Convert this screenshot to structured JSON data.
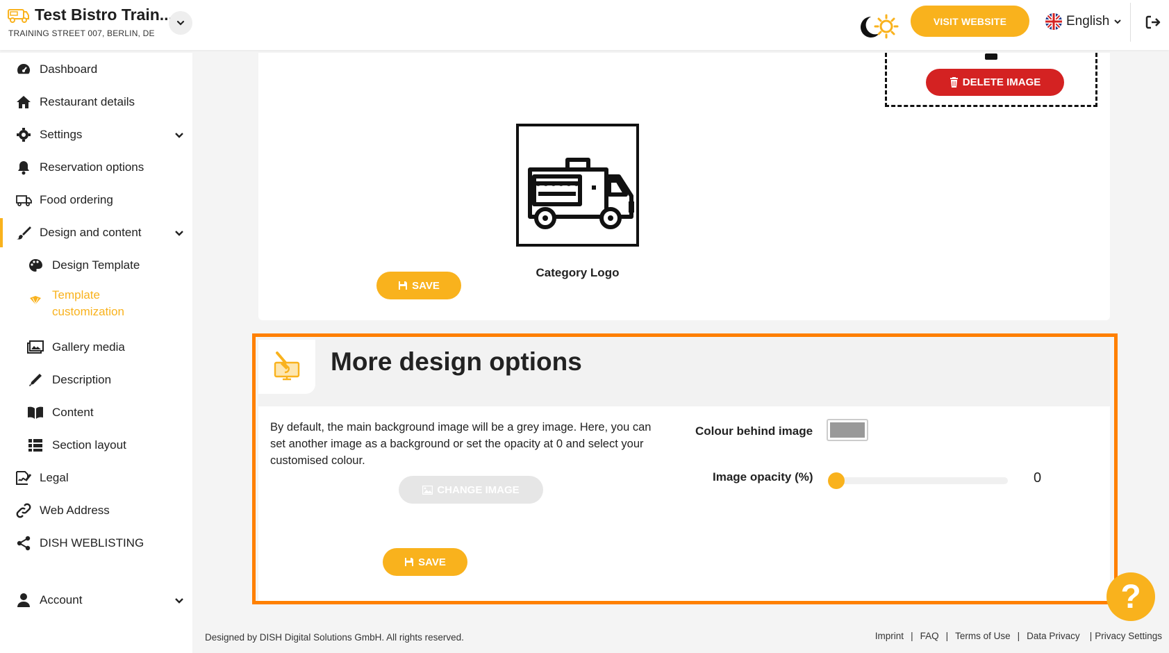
{
  "header": {
    "restaurant_name": "Test Bistro Train...",
    "address": "TRAINING STREET 007, BERLIN, DE",
    "visit_website": "VISIT WEBSITE",
    "language": "English"
  },
  "sidebar": {
    "items": [
      {
        "label": "Dashboard",
        "icon": "dashboard-icon"
      },
      {
        "label": "Restaurant details",
        "icon": "home-icon"
      },
      {
        "label": "Settings",
        "icon": "gear-icon"
      },
      {
        "label": "Reservation options",
        "icon": "bell-icon"
      },
      {
        "label": "Food ordering",
        "icon": "food-ordering-icon"
      },
      {
        "label": "Design and content",
        "icon": "brush-icon"
      },
      {
        "label": "Design Template",
        "icon": "palette-icon"
      },
      {
        "label": "Template customization",
        "icon": "template-icon"
      },
      {
        "label": "Gallery media",
        "icon": "gallery-icon"
      },
      {
        "label": "Description",
        "icon": "pen-icon"
      },
      {
        "label": "Content",
        "icon": "book-icon"
      },
      {
        "label": "Section layout",
        "icon": "list-icon"
      },
      {
        "label": "Legal",
        "icon": "signature-icon"
      },
      {
        "label": "Web Address",
        "icon": "link-icon"
      },
      {
        "label": "DISH WEBLISTING",
        "icon": "share-icon"
      },
      {
        "label": "Account",
        "icon": "user-icon"
      }
    ]
  },
  "top_card": {
    "delete_image": "DELETE IMAGE",
    "category_logo_label": "Category Logo",
    "save": "SAVE"
  },
  "more_design": {
    "title": "More design options",
    "description": "By default, the main background image will be a grey image. Here, you can set another image as a background or set the opacity at 0 and select your customised colour.",
    "change_image": "CHANGE IMAGE",
    "colour_label": "Colour behind image",
    "colour_value": "#999999",
    "opacity_label": "Image opacity (%)",
    "opacity_value": "0",
    "save": "SAVE"
  },
  "footer": {
    "copyright": "Designed by DISH Digital Solutions GmbH. All rights reserved.",
    "links": [
      "Imprint",
      "FAQ",
      "Terms of Use",
      "Data Privacy",
      "Privacy Settings"
    ]
  },
  "colors": {
    "accent": "#f9b21d",
    "danger": "#d42222",
    "highlight": "#ff8000"
  }
}
